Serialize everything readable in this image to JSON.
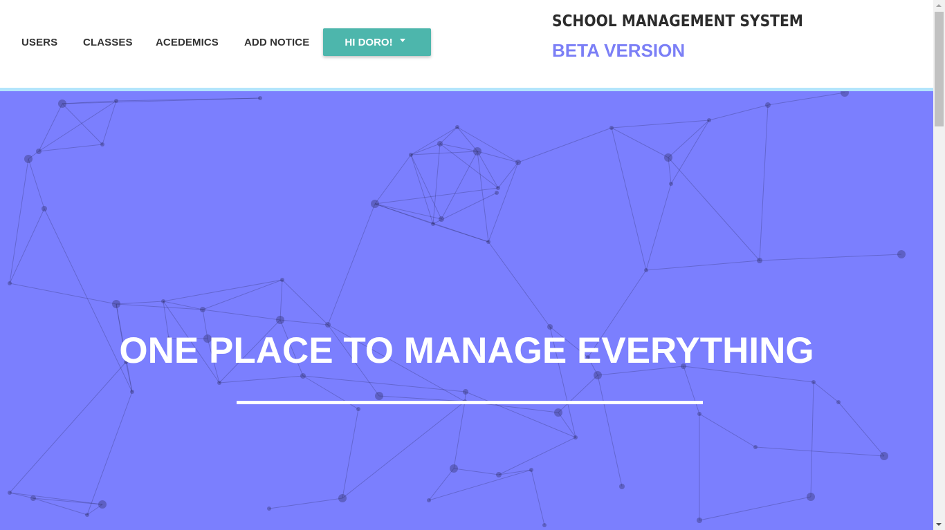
{
  "navbar": {
    "links": [
      {
        "label": "USERS"
      },
      {
        "label": "CLASSES"
      },
      {
        "label": "ACEDEMICS"
      },
      {
        "label": "ADD NOTICE"
      }
    ],
    "user_button": {
      "label": "HI DORO!",
      "icon": "caret-down-icon"
    },
    "brand": {
      "title": "SCHOOL MANAGEMENT SYSTEM",
      "subtitle": "BETA VERSION"
    }
  },
  "hero": {
    "title": "ONE PLACE TO MANAGE EVERYTHING"
  },
  "colors": {
    "accent_teal": "#4db6ac",
    "hero_background": "#7b7ffe",
    "brand_subtitle": "#7b7ff6",
    "accent_line": "#b3e5fc",
    "text_dark": "#333333"
  }
}
